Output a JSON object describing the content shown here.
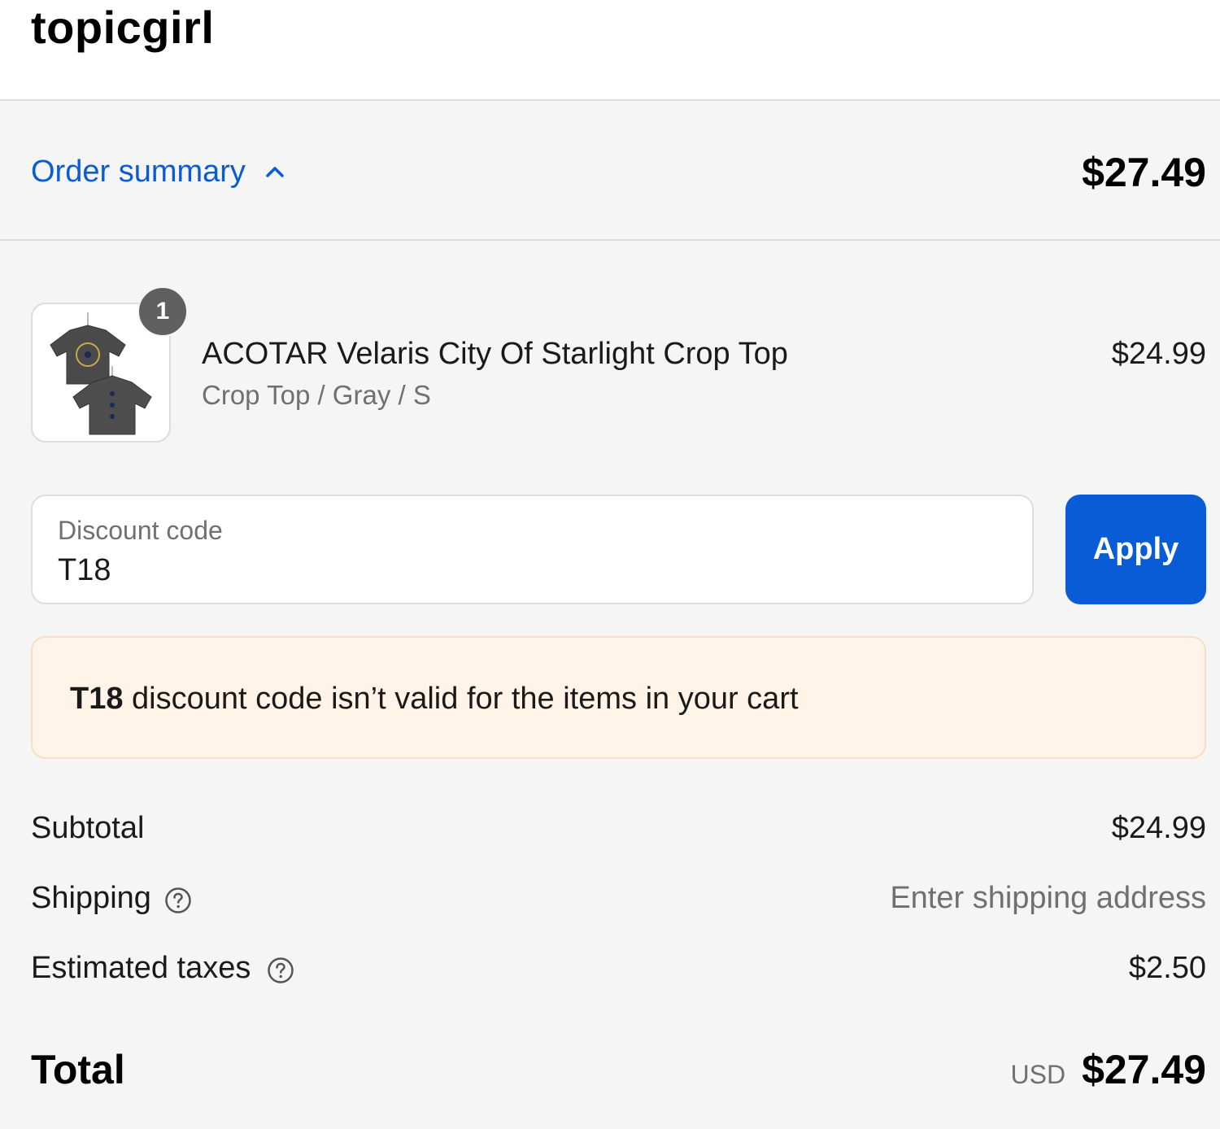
{
  "header": {
    "brand": "topicgirl"
  },
  "summary": {
    "toggle_label": "Order summary",
    "toggle_icon": "chevron-up-icon",
    "total": "$27.49"
  },
  "cart": {
    "items": [
      {
        "quantity": "1",
        "name": "ACOTAR Velaris City Of Starlight Crop Top",
        "variant": "Crop Top / Gray / S",
        "price": "$24.99",
        "image_icon": "crop-top-thumbnail"
      }
    ]
  },
  "discount": {
    "label": "Discount code",
    "value": "T18",
    "apply_label": "Apply"
  },
  "notice": {
    "code": "T18",
    "message": " discount code isn’t valid for the items in your cart"
  },
  "lines": {
    "subtotal_label": "Subtotal",
    "subtotal_value": "$24.99",
    "shipping_label": "Shipping",
    "shipping_value": "Enter shipping address",
    "taxes_label": "Estimated taxes",
    "taxes_value": "$2.50"
  },
  "total": {
    "label": "Total",
    "currency": "USD",
    "amount": "$27.49"
  },
  "colors": {
    "accent": "#0a5bd6",
    "notice_bg": "#fff4e7",
    "notice_border": "#f7dfbf",
    "page_bg": "#f5f5f5"
  }
}
